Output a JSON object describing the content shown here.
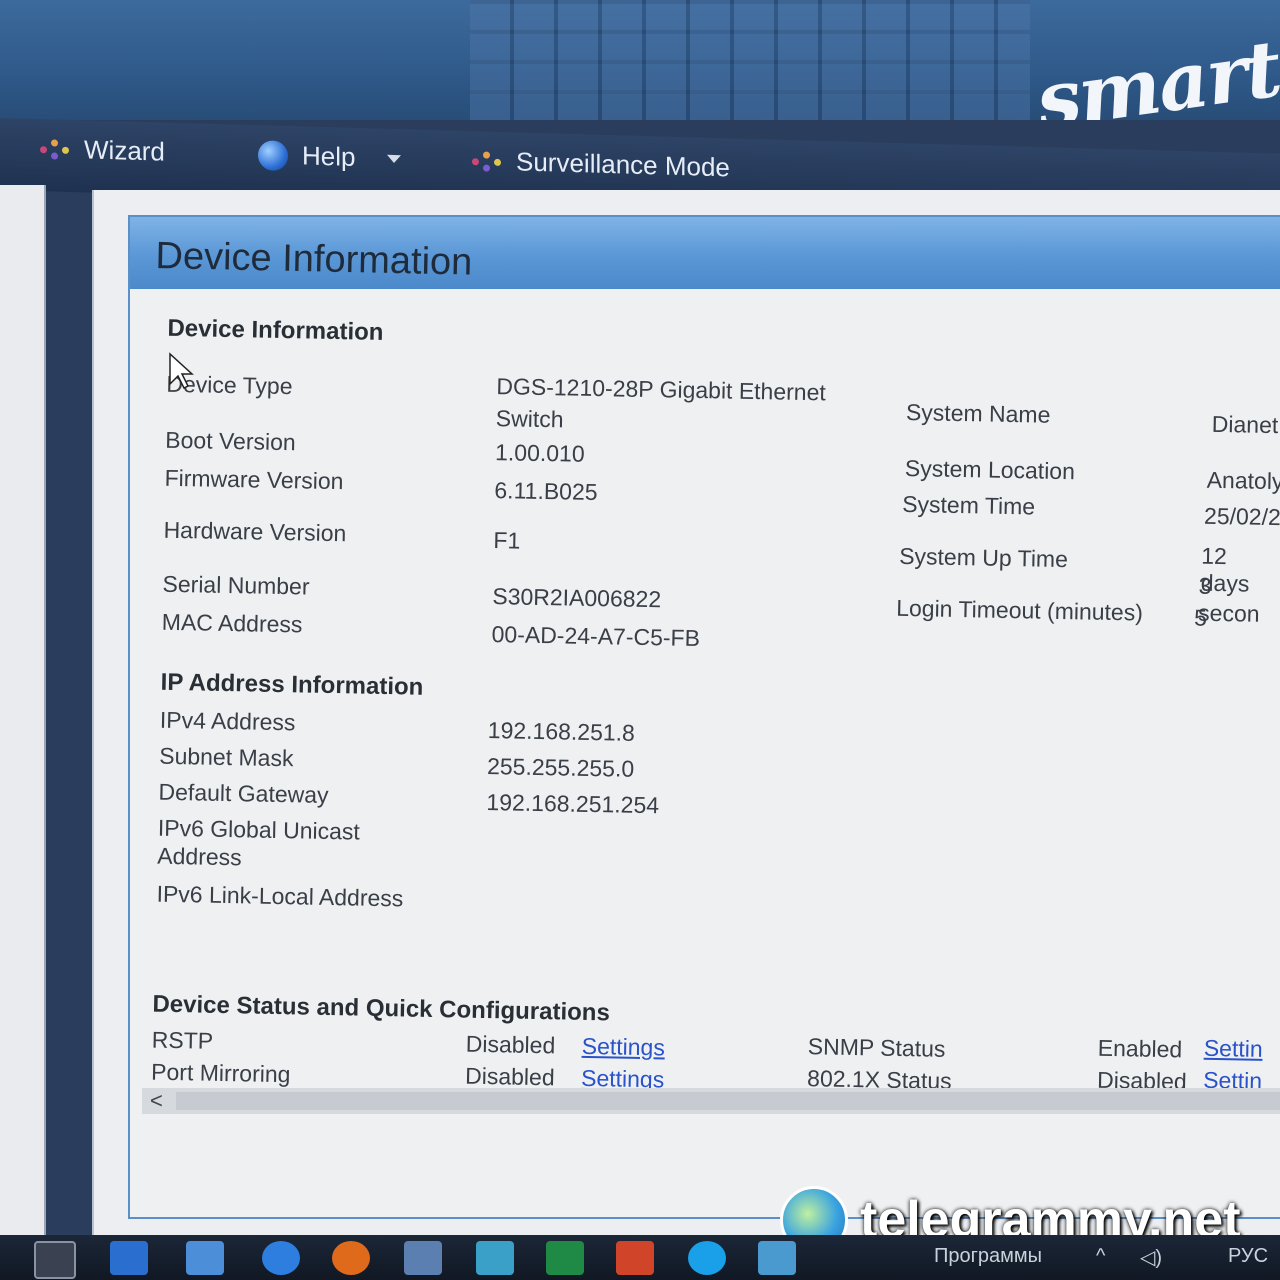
{
  "banner": {
    "brand": "smart"
  },
  "menu": {
    "items": [
      {
        "label": "Wizard",
        "icon": "wizard-sparkle-icon"
      },
      {
        "label": "Help",
        "icon": "globe-help-icon"
      },
      {
        "label": "Surveillance Mode",
        "icon": "surveillance-sparkle-icon"
      }
    ]
  },
  "panel": {
    "title": "Device Information"
  },
  "device_info": {
    "heading": "Device Information",
    "rows": [
      {
        "label": "Device Type",
        "value": "DGS-1210-28P Gigabit Ethernet",
        "value2": "Switch"
      },
      {
        "label": "Boot Version",
        "value": "1.00.010"
      },
      {
        "label": "Firmware Version",
        "value": "6.11.B025"
      },
      {
        "label": "Hardware Version",
        "value": "F1"
      },
      {
        "label": "Serial Number",
        "value": "S30R2IA006822"
      },
      {
        "label": "MAC Address",
        "value": "00-AD-24-A7-C5-FB"
      }
    ],
    "system": [
      {
        "label": "System Name",
        "value": "Dianet"
      },
      {
        "label": "System Location",
        "value": "Anatoly"
      },
      {
        "label": "System Time",
        "value": "25/02/2"
      },
      {
        "label": "System Up Time",
        "value": "12 days",
        "value2": "3 secon"
      },
      {
        "label": "Login Timeout (minutes)",
        "value": "5"
      }
    ]
  },
  "ip_info": {
    "heading": "IP Address Information",
    "rows": [
      {
        "label": "IPv4 Address",
        "value": "192.168.251.8"
      },
      {
        "label": "Subnet Mask",
        "value": "255.255.255.0"
      },
      {
        "label": "Default Gateway",
        "value": "192.168.251.254"
      },
      {
        "label": "IPv6 Global Unicast",
        "label2": "Address",
        "value": ""
      },
      {
        "label": "IPv6 Link-Local Address",
        "value": ""
      }
    ]
  },
  "status": {
    "heading": "Device Status and Quick Configurations",
    "rows": [
      {
        "label": "RSTP",
        "value": "Disabled",
        "link": "Settings",
        "label_r": "SNMP Status",
        "value_r": "Enabled",
        "link_r": "Settin"
      },
      {
        "label": "Port Mirroring",
        "value": "Disabled",
        "link": "Settings",
        "label_r": "802.1X Status",
        "value_r": "Disabled",
        "link_r": "Settin"
      }
    ]
  },
  "scrollbar": {
    "left_arrow": "<"
  },
  "taskbar": {
    "programs_label": "Программы",
    "lang": "РУС"
  },
  "watermark": {
    "text": "telegrammy.net"
  }
}
